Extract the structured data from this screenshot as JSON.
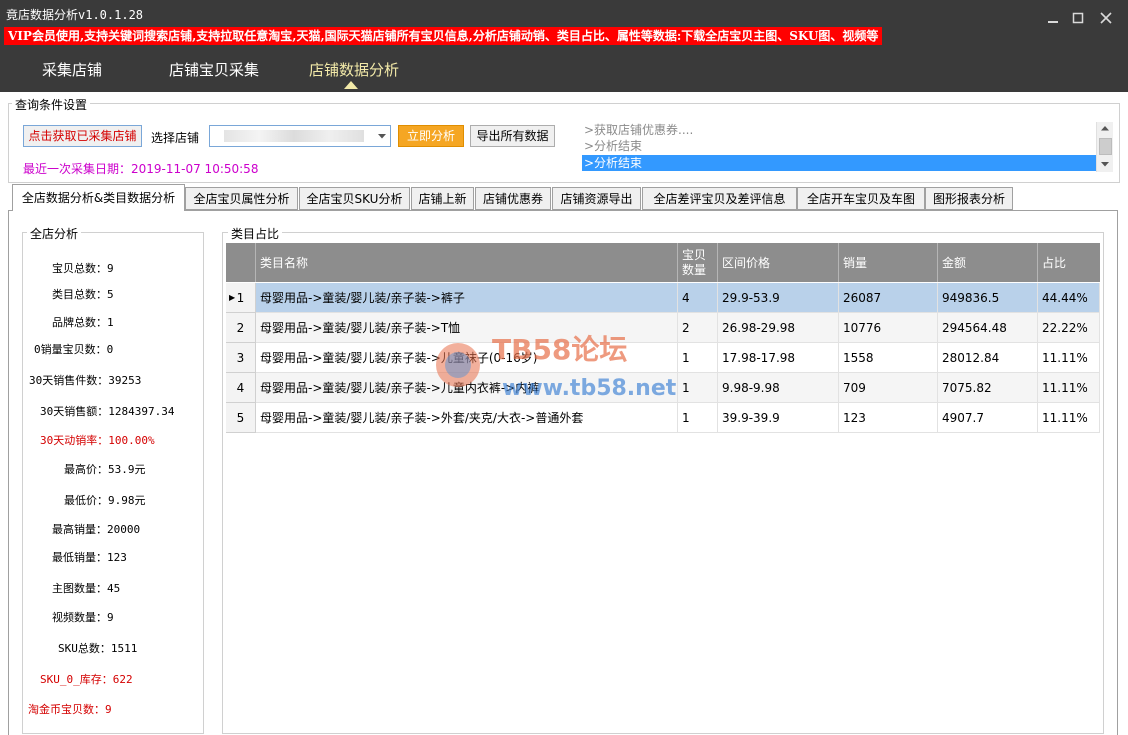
{
  "app": {
    "title": "竟店数据分析v1.0.1.28",
    "banner": "VIP会员使用,支持关键词搜索店铺,支持拉取任意淘宝,天猫,国际天猫店铺所有宝贝信息,分析店铺动销、类目占比、属性等数据:下载全店宝贝主图、SKU图、视频等"
  },
  "window_controls": {
    "minimize": "—",
    "maximize": "☐",
    "close": "✕"
  },
  "nav": {
    "tabs": [
      "采集店铺",
      "店铺宝贝采集",
      "店铺数据分析"
    ],
    "active": "店铺数据分析"
  },
  "query": {
    "group_title": "查询条件设置",
    "fetch_button": "点击获取已采集店铺",
    "store_label": "选择店铺",
    "analyze_button": "立即分析",
    "export_button": "导出所有数据",
    "last_collect": "最近一次采集日期：2019-11-07 10:50:58",
    "log": [
      ">获取店铺优惠券....",
      ">分析结束",
      ">分析结束"
    ]
  },
  "subtabs": [
    "全店数据分析&类目数据分析",
    "全店宝贝属性分析",
    "全店宝贝SKU分析",
    "店铺上新",
    "店铺优惠券",
    "店铺资源导出",
    "全店差评宝贝及差评信息",
    "全店开车宝贝及车图",
    "图形报表分析"
  ],
  "summary": {
    "title": "全店分析",
    "stats": [
      "宝贝总数：9",
      "类目总数：5",
      "品牌总数：1",
      "0销量宝贝数：0",
      "30天销售件数：39253",
      "30天销售额：1284397.34",
      "30天动销率：100.00%",
      "最高价：53.9元",
      "最低价：9.98元",
      "最高销量：20000",
      "最低销量：123",
      "主图数量：45",
      "视频数量：9",
      "SKU总数：1511",
      "SKU_0_库存：622",
      "淘金币宝贝数：9"
    ],
    "red_color": "#d40000"
  },
  "category": {
    "title": "类目占比",
    "headers": [
      "类目名称",
      "宝贝\n数量",
      "区间价格",
      "销量",
      "金额",
      "占比"
    ],
    "rows": [
      [
        "1",
        "母婴用品->童装/婴儿装/亲子装->裤子",
        "4",
        "29.9-53.9",
        "26087",
        "949836.5",
        "44.44%"
      ],
      [
        "2",
        "母婴用品->童装/婴儿装/亲子装->T恤",
        "2",
        "26.98-29.98",
        "10776",
        "294564.48",
        "22.22%"
      ],
      [
        "3",
        "母婴用品->童装/婴儿装/亲子装->儿童袜子(0-16岁)",
        "1",
        "17.98-17.98",
        "1558",
        "28012.84",
        "11.11%"
      ],
      [
        "4",
        "母婴用品->童装/婴儿装/亲子装->儿童内衣裤->内裤",
        "1",
        "9.98-9.98",
        "709",
        "7075.82",
        "11.11%"
      ],
      [
        "5",
        "母婴用品->童装/婴儿装/亲子装->外套/夹克/大衣->普通外套",
        "1",
        "39.9-39.9",
        "123",
        "4907.7",
        "11.11%"
      ]
    ],
    "selected_row": 1,
    "selected_color": "#b9d1ea"
  },
  "watermark": {
    "line1": "TB58论坛",
    "line2": "www.tb58.net",
    "color": "#e8704a"
  }
}
